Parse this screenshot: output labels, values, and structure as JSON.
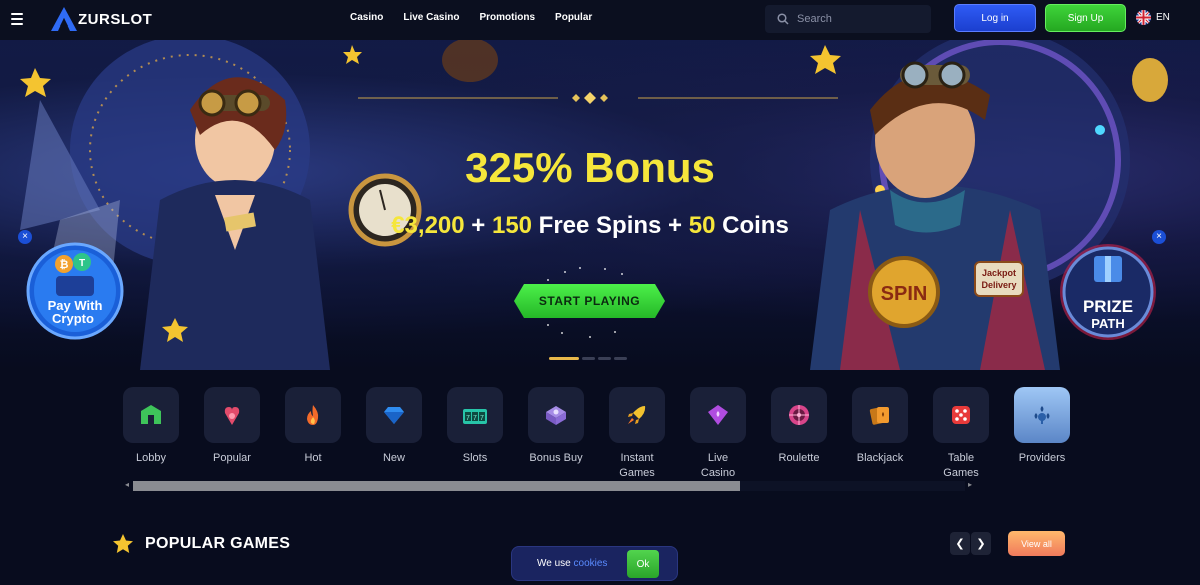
{
  "header": {
    "logo_text": "ZURSLOT",
    "nav": [
      "Casino",
      "Live Casino",
      "Promotions",
      "Popular"
    ],
    "search_placeholder": "Search",
    "login_label": "Log in",
    "signup_label": "Sign Up",
    "language": "EN"
  },
  "hero": {
    "title": "325% Bonus",
    "subtitle_parts": [
      "€3,200",
      " + ",
      "150",
      " Free Spins + ",
      "50",
      " Coins"
    ],
    "cta_label": "START PLAYING",
    "slides": 4,
    "active_slide": 1,
    "badge_left_line1": "Pay With",
    "badge_left_line2": "Crypto",
    "badge_right_line1": "PRIZE",
    "badge_right_line2": "PATH",
    "spin_label": "SPIN",
    "jackpot_label_1": "Jackpot",
    "jackpot_label_2": "Delivery"
  },
  "categories": [
    {
      "label": "Lobby",
      "icon": "lobby-icon",
      "color": "#3ec45a"
    },
    {
      "label": "Popular",
      "icon": "popular-icon",
      "color": "#e34b6b"
    },
    {
      "label": "Hot",
      "icon": "fire-icon",
      "color": "#f26a2a"
    },
    {
      "label": "New",
      "icon": "diamond-icon",
      "color": "#2f8cf0"
    },
    {
      "label": "Slots",
      "icon": "slots-icon",
      "color": "#27c4a8"
    },
    {
      "label": "Bonus Buy",
      "icon": "bonus-buy-icon",
      "color": "#8a6bd6"
    },
    {
      "label": "Instant Games",
      "icon": "rocket-icon",
      "color": "#f2c12e"
    },
    {
      "label": "Live Casino",
      "icon": "live-casino-icon",
      "color": "#b04ce0"
    },
    {
      "label": "Roulette",
      "icon": "roulette-icon",
      "color": "#d8458a"
    },
    {
      "label": "Blackjack",
      "icon": "blackjack-icon",
      "color": "#f29a2e"
    },
    {
      "label": "Table Games",
      "icon": "dice-icon",
      "color": "#e83a3a"
    },
    {
      "label": "Providers",
      "icon": "providers-icon",
      "color": "#2a5fa8"
    }
  ],
  "popular": {
    "title": "POPULAR GAMES",
    "view_all_label": "View all"
  },
  "cookie": {
    "text": "We use",
    "link": "cookies",
    "ok_label": "Ok"
  }
}
